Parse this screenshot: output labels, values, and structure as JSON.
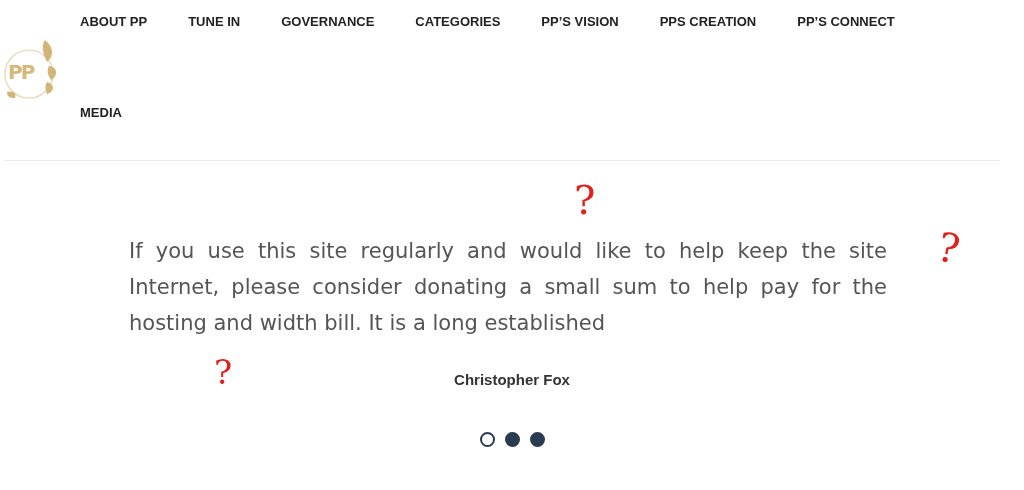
{
  "logo": {
    "text": "PP"
  },
  "nav": [
    {
      "label": "ABOUT PP"
    },
    {
      "label": "TUNE IN"
    },
    {
      "label": "GOVERNANCE"
    },
    {
      "label": "CATEGORIES"
    },
    {
      "label": "PP’S VISION"
    },
    {
      "label": "PPS CREATION"
    },
    {
      "label": "PP’S CONNECT"
    },
    {
      "label": "MEDIA"
    }
  ],
  "testimonial": {
    "quote": "If you use this site regularly and would like to help keep the site Internet, please consider donating a small sum to help pay for the hosting and width bill. It is a long established",
    "author": "Christopher Fox"
  },
  "slider_dots": [
    {
      "selected": true
    },
    {
      "selected": false
    },
    {
      "selected": false
    }
  ],
  "annotations": [
    {
      "text": "?"
    },
    {
      "text": "?"
    },
    {
      "text": "?"
    }
  ]
}
